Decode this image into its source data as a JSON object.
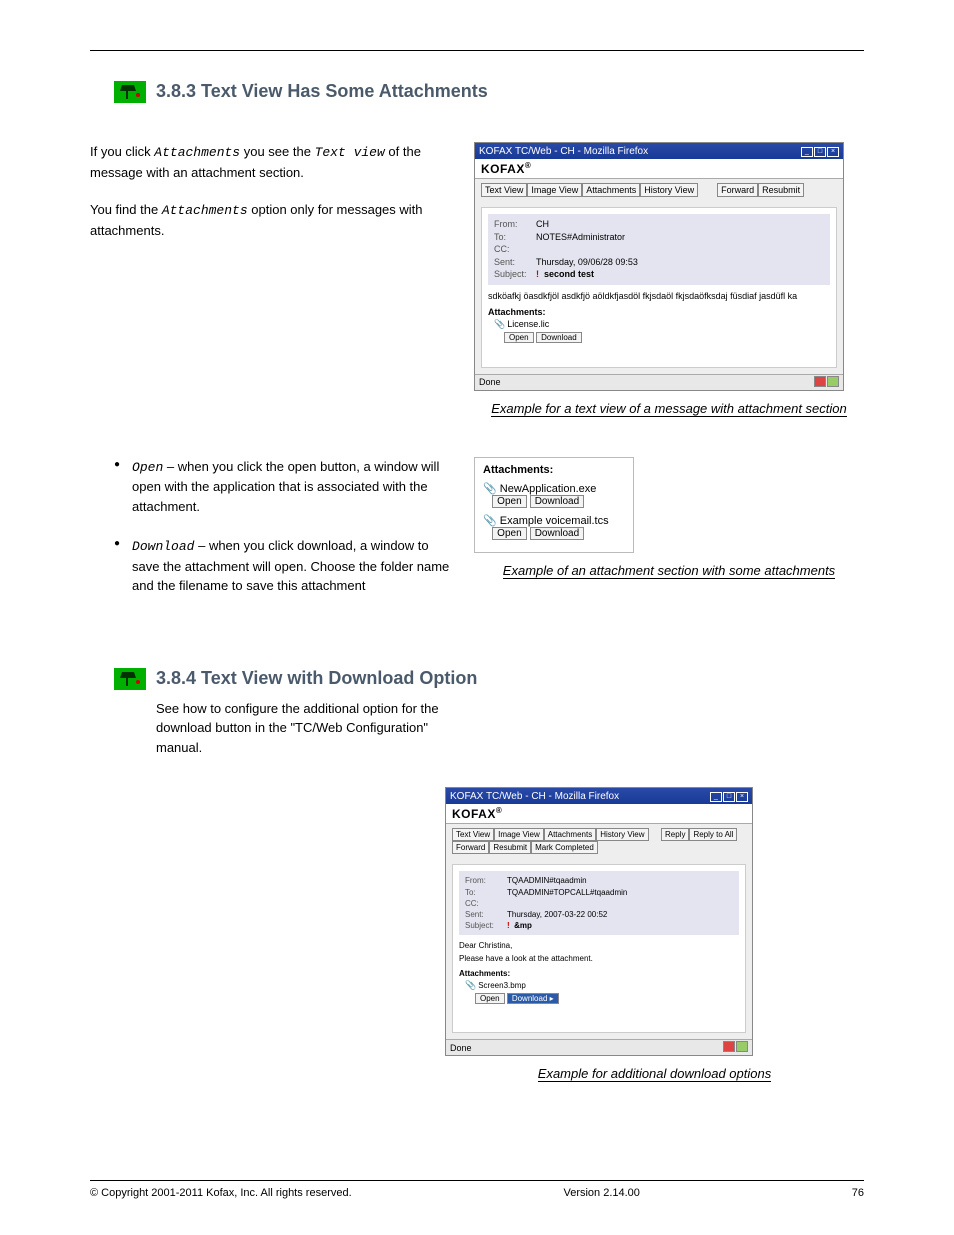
{
  "heading1": "3.8.3 Text View Has Some Attachments",
  "heading2": "3.8.4 Text View with Download Option",
  "para1_a": "If you click ",
  "para1_b": "Attachments",
  "para1_c": " you see the ",
  "para1_d": "Text view",
  "para1_e": " of the message with an attachment section.",
  "para2_a": "You find the ",
  "para2_b": "Attachments",
  "para2_c": " option only for messages with attachments.",
  "open_term": "Open",
  "open_desc_a": "–",
  "open_desc_b": " when you click the open button, a window will open with the application that is associated with the attachment.",
  "download_term": "Download",
  "download_desc_a": "–",
  "download_desc_b": " when you click download, a window to save the attachment will open. Choose the folder name and the filename to save this attachment",
  "note2_a": "See how to configure the additional option for the download button in the ",
  "note2_b": "\"TC/Web Configuration\" manual",
  "note2_c": ".",
  "caption1": "Example for a text view of a message with attachment section",
  "caption2": "Example of an attachment section with some attachments",
  "caption3": "Example for additional download options",
  "shot1": {
    "wintitle": "KOFAX TC/Web - CH - Mozilla Firefox",
    "brand": "KOFAX",
    "tabs": [
      "Text View",
      "Image View",
      "Attachments",
      "History View"
    ],
    "actions": [
      "Forward",
      "Resubmit"
    ],
    "from_l": "From:",
    "from_v": "CH",
    "to_l": "To:",
    "to_v": "NOTES#Administrator",
    "cc_l": "CC:",
    "cc_v": "",
    "sent_l": "Sent:",
    "sent_v": "Thursday, 09/06/28 09:53",
    "subj_l": "Subject:",
    "prio": "!",
    "subj_v": "second test",
    "body": "sdköafkj öasdkfjöl asdkfjö aöldkfjasdöl fkjsdaöl fkjsdaöfksdaj füsdiaf jasdüfl ka",
    "attach_h": "Attachments:",
    "att_name": "License.lic",
    "open": "Open",
    "download": "Download",
    "status": "Done"
  },
  "shot2": {
    "h": "Attachments:",
    "a1": "NewApplication.exe",
    "a2": "Example voicemail.tcs",
    "open": "Open",
    "download": "Download"
  },
  "shot3": {
    "wintitle": "KOFAX TC/Web - CH - Mozilla Firefox",
    "brand": "KOFAX",
    "tabs": [
      "Text View",
      "Image View",
      "Attachments",
      "History View"
    ],
    "actions": [
      "Reply",
      "Reply to All",
      "Forward",
      "Resubmit",
      "Mark Completed"
    ],
    "from_l": "From:",
    "from_v": "TQAADMIN#tqaadmin",
    "to_l": "To:",
    "to_v": "TQAADMIN#TOPCALL#tqaadmin",
    "cc_l": "CC:",
    "cc_v": "",
    "sent_l": "Sent:",
    "sent_v": "Thursday, 2007-03-22 00:52",
    "subj_l": "Subject:",
    "prio": "!",
    "subj_v": "&mp",
    "line1": "Dear Christina,",
    "line2": "Please have a look at the attachment.",
    "attach_h": "Attachments:",
    "att_name": "Screen3.bmp",
    "open": "Open",
    "download": "Download ▸",
    "status": "Done"
  },
  "footer_left": "© Copyright 2001-2011 Kofax, Inc. All rights reserved.",
  "footer_center": "Version 2.14.00",
  "footer_right": "76"
}
